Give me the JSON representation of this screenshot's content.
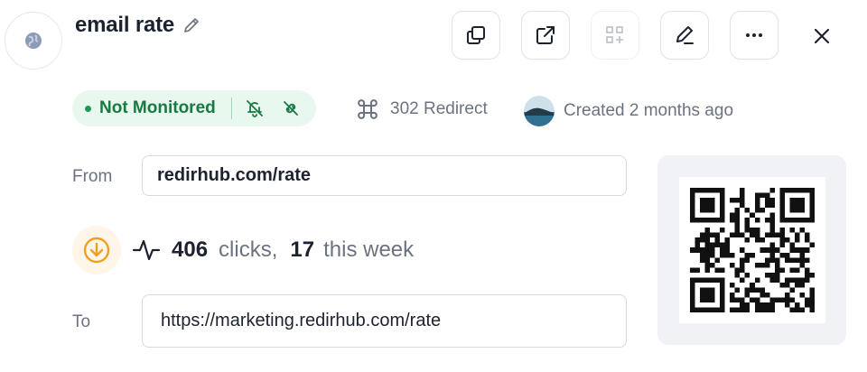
{
  "link": {
    "title": "email rate",
    "status": "Not Monitored",
    "redirect_type": "302 Redirect",
    "created": "Created 2 months ago"
  },
  "fields": {
    "from_label": "From",
    "from_value": "redirhub.com/rate",
    "to_label": "To",
    "to_value": "https://marketing.redirhub.com/rate"
  },
  "stats": {
    "clicks": "406",
    "clicks_label": "clicks,",
    "week": "17",
    "week_label": "this week"
  },
  "toolbar": {
    "buttons": [
      "copy-icon",
      "open-external-icon",
      "qr-add-icon",
      "edit-icon",
      "more-icon",
      "close-icon"
    ]
  },
  "colors": {
    "status_bg": "#e9f8ef",
    "status_text": "#187a43",
    "stat_accent": "#f0a020"
  }
}
